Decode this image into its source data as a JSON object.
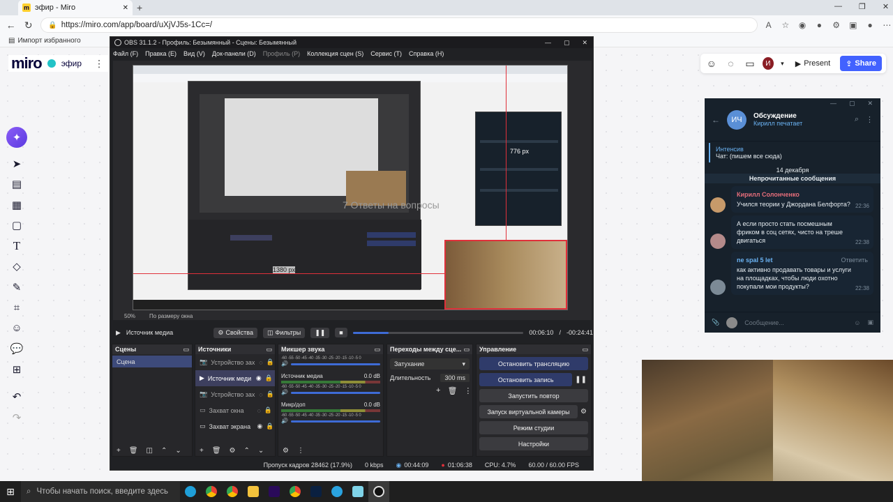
{
  "browser": {
    "tab_title": "эфир - Miro",
    "url": "https://miro.com/app/board/uXjVJ5s-1Cc=/",
    "bookmark": "Импорт избранного"
  },
  "miro": {
    "logo": "miro",
    "board_name": "эфир",
    "present_label": "Present",
    "share_label": "Share",
    "avatar_initial": "И",
    "tools": [
      "cursor-icon",
      "templates-icon",
      "table-icon",
      "sticky-note-icon",
      "text-icon",
      "shapes-icon",
      "pen-icon",
      "frame-icon",
      "emoji-icon",
      "comment-icon",
      "plus-icon",
      "undo-icon",
      "redo-icon"
    ]
  },
  "obs": {
    "title": "OBS 31.1.2 - Профиль: Безымянный - Сцены: Безымянный",
    "menu": [
      "Файл (F)",
      "Правка (E)",
      "Вид (V)",
      "Док-панели (D)",
      "Профиль (P)",
      "Коллекция сцен (S)",
      "Сервис (T)",
      "Справка (H)"
    ],
    "zoom": "50%",
    "zoom_mode": "По размеру окна",
    "media_source": "Источник медиа",
    "properties": "Свойства",
    "filters": "Фильтры",
    "time_current": "00:06:10",
    "time_remaining": "-00:24:41",
    "seek_progress": 0.21,
    "scenes_title": "Сцены",
    "scenes": [
      "Сцена"
    ],
    "sources_title": "Источники",
    "sources": [
      {
        "label": "Устройство зах",
        "icon": "camera-icon",
        "active": false
      },
      {
        "label": "Источник меди",
        "icon": "play-icon",
        "active": true
      },
      {
        "label": "Устройство зах",
        "icon": "camera-icon",
        "active": false
      },
      {
        "label": "Захват окна",
        "icon": "window-icon",
        "active": false
      },
      {
        "label": "Захват экрана",
        "icon": "monitor-icon",
        "active": false
      }
    ],
    "mixer_title": "Микшер звука",
    "mixer_scale": "-60 -55 -50 -45 -40 -35 -30 -25 -20 -15 -10 -5 0",
    "mixer": [
      {
        "name": "",
        "db": ""
      },
      {
        "name": "Источник медиа",
        "db": "0.0 dB"
      },
      {
        "name": "Микр/доп",
        "db": "0.0 dB"
      }
    ],
    "transitions_title": "Переходы между сце...",
    "transition": "Затухание",
    "duration_label": "Длительность",
    "duration_value": "300 ms",
    "controls_title": "Управление",
    "controls": [
      "Остановить трансляцию",
      "Остановить запись",
      "Запустить повтор",
      "Запуск виртуальной камеры",
      "Режим студии",
      "Настройки"
    ],
    "status": {
      "dropped": "Пропуск кадров 28462 (17.9%)",
      "kbps": "0 kbps",
      "stream_time": "00:44:09",
      "rec_time": "01:06:38",
      "cpu": "CPU: 4.7%",
      "fps": "60.00 / 60.00 FPS"
    },
    "preview_text": "7 Ответы на вопросы",
    "preview_size_label": "1380 px",
    "preview_size_label_2": "776 px"
  },
  "telegram": {
    "avatar": "ИЧ",
    "title": "Обсуждение",
    "status": "Кирилл печатает",
    "pinned_title": "Интенсив",
    "pinned_text": "Чат: (пишем все сюда)",
    "date": "14 декабря",
    "unread": "Непрочитанные сообщения",
    "messages": [
      {
        "sender": "Кирилл Солонченко",
        "text": "Учился теории у Джордана Белфорта?",
        "time": "22:36",
        "reply": ""
      },
      {
        "sender": "",
        "text": "А если просто стать посмешным фриком в соц сетях, чисто на треше двигаться",
        "time": "22:38",
        "reply": ""
      },
      {
        "sender": "ne spal 5 let",
        "text": "как активно продавать товары и услуги на площадках, чтобы люди охотно покупали мои продукты?",
        "time": "22:38",
        "reply": "Ответить"
      }
    ],
    "input_placeholder": "Сообщение...",
    "accent": "#6ab2f2"
  },
  "taskbar": {
    "search_placeholder": "Чтобы начать поиск, введите здесь",
    "apps": [
      "edge-icon",
      "chrome-icon",
      "chrome-icon",
      "explorer-icon",
      "premiere-icon",
      "chrome-icon",
      "photoshop-icon",
      "telegram-icon",
      "app-icon",
      "obs-icon"
    ]
  },
  "colors": {
    "miro_accent": "#4262ff",
    "obs_selected": "#3d3f5e",
    "tg_bg": "#17212b",
    "guide_red": "#e0303a"
  }
}
